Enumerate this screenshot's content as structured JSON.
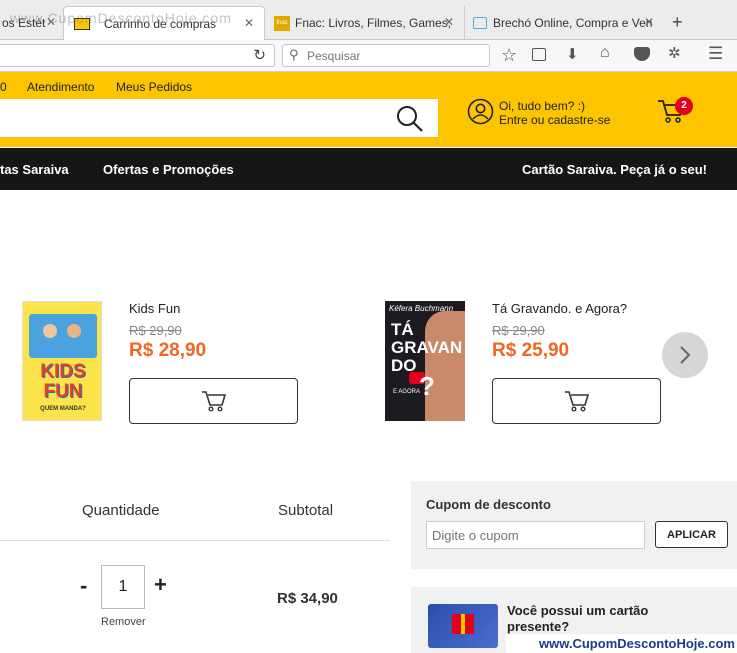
{
  "browser": {
    "tabs": [
      {
        "label": "os Estét",
        "active": false
      },
      {
        "label": "Carrinho de compras",
        "active": true
      },
      {
        "label": "Fnac: Livros, Filmes, Games, ",
        "active": false
      },
      {
        "label": "Brechó Online, Compra e Ven",
        "active": false
      }
    ],
    "fnac_favicon": "fnac",
    "search_placeholder": "Pesquisar"
  },
  "watermark": {
    "top": "www.CupomDescontoHoje.com",
    "bottom": "www.CupomDescontoHoje.com"
  },
  "topbar": {
    "links": [
      "0",
      "Atendimento",
      "Meus Pedidos"
    ],
    "greeting": "Oi, tudo bem? :)",
    "login": "Entre ou cadastre-se",
    "cart_count": "2"
  },
  "nav": {
    "left_item": "tas Saraiva",
    "offers": "Ofertas e Promoções",
    "card": "Cartão Saraiva. Peça já o seu!"
  },
  "recommendations": [
    {
      "name": "Kids Fun",
      "old_price": "R$ 29,90",
      "price": "R$ 28,90",
      "cover_title": "KIDS FUN",
      "cover_sub": "QUEM MANDA?"
    },
    {
      "name": "Tá Gravando. e Agora?",
      "old_price": "R$ 29,90",
      "price": "R$ 25,90",
      "cover_author": "Kéfera Buchmann",
      "cover_title": "TÁ GRAVAN DO",
      "cover_sub": "E AGORA"
    }
  ],
  "cart_table": {
    "quantity_header": "Quantidade",
    "subtotal_header": "Subtotal",
    "minus": "-",
    "plus": "+",
    "quantity": "1",
    "remove": "Remover",
    "subtotal": "R$ 34,90"
  },
  "coupon": {
    "title": "Cupom de desconto",
    "placeholder": "Digite o cupom",
    "apply": "APLICAR"
  },
  "card_promo": {
    "text": "Você possui um cartão presente?"
  },
  "colors": {
    "brand_yellow": "#fcc500",
    "price_orange": "#f26522",
    "badge_red": "#e3001b"
  }
}
